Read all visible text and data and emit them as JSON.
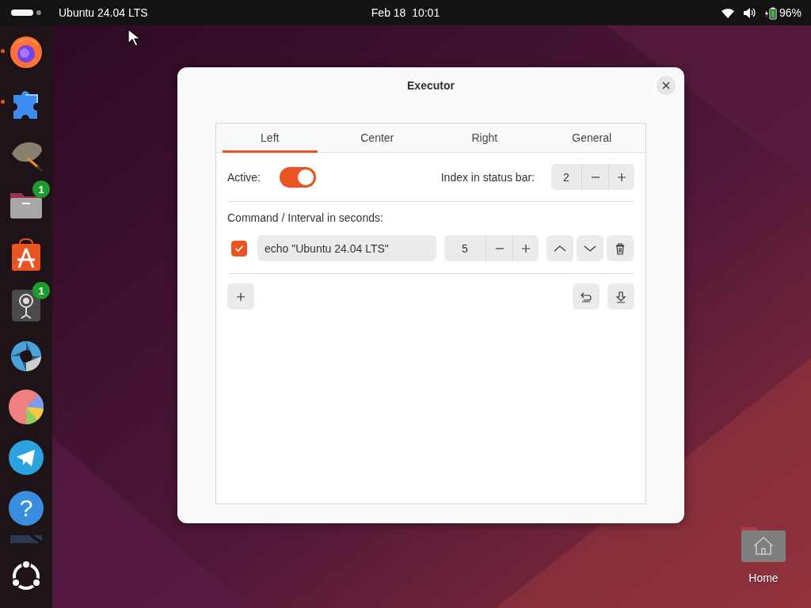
{
  "top_bar": {
    "app_menu": "Ubuntu 24.04 LTS",
    "clock": "Feb 18  10:01",
    "battery": "96%"
  },
  "dock": {
    "items": [
      {
        "kind": "firefox",
        "running": true
      },
      {
        "kind": "puzzle",
        "running": true
      },
      {
        "kind": "brush",
        "running": false
      },
      {
        "kind": "folder",
        "running": false,
        "badge": "1"
      },
      {
        "kind": "store",
        "running": false
      },
      {
        "kind": "camera",
        "running": false,
        "badge": "1"
      },
      {
        "kind": "aperture",
        "running": false
      },
      {
        "kind": "pie",
        "running": false
      },
      {
        "kind": "plane",
        "running": false
      },
      {
        "kind": "help",
        "running": false,
        "glyph": "?"
      },
      {
        "kind": "partial",
        "running": false
      },
      {
        "kind": "ubuntu",
        "running": false
      }
    ]
  },
  "window": {
    "title": "Executor",
    "tabs": [
      {
        "label": "Left",
        "selected": true
      },
      {
        "label": "Center",
        "selected": false
      },
      {
        "label": "Right",
        "selected": false
      },
      {
        "label": "General",
        "selected": false
      }
    ],
    "active": {
      "label": "Active:",
      "on": true
    },
    "index": {
      "label": "Index in status bar:",
      "value": "2"
    },
    "commands_label": "Command / Interval in seconds:",
    "commands": [
      {
        "checked": true,
        "command": "echo \"Ubuntu 24.04 LTS\"",
        "interval": "5"
      }
    ]
  },
  "desktop_icons": [
    {
      "label": "Home"
    }
  ]
}
